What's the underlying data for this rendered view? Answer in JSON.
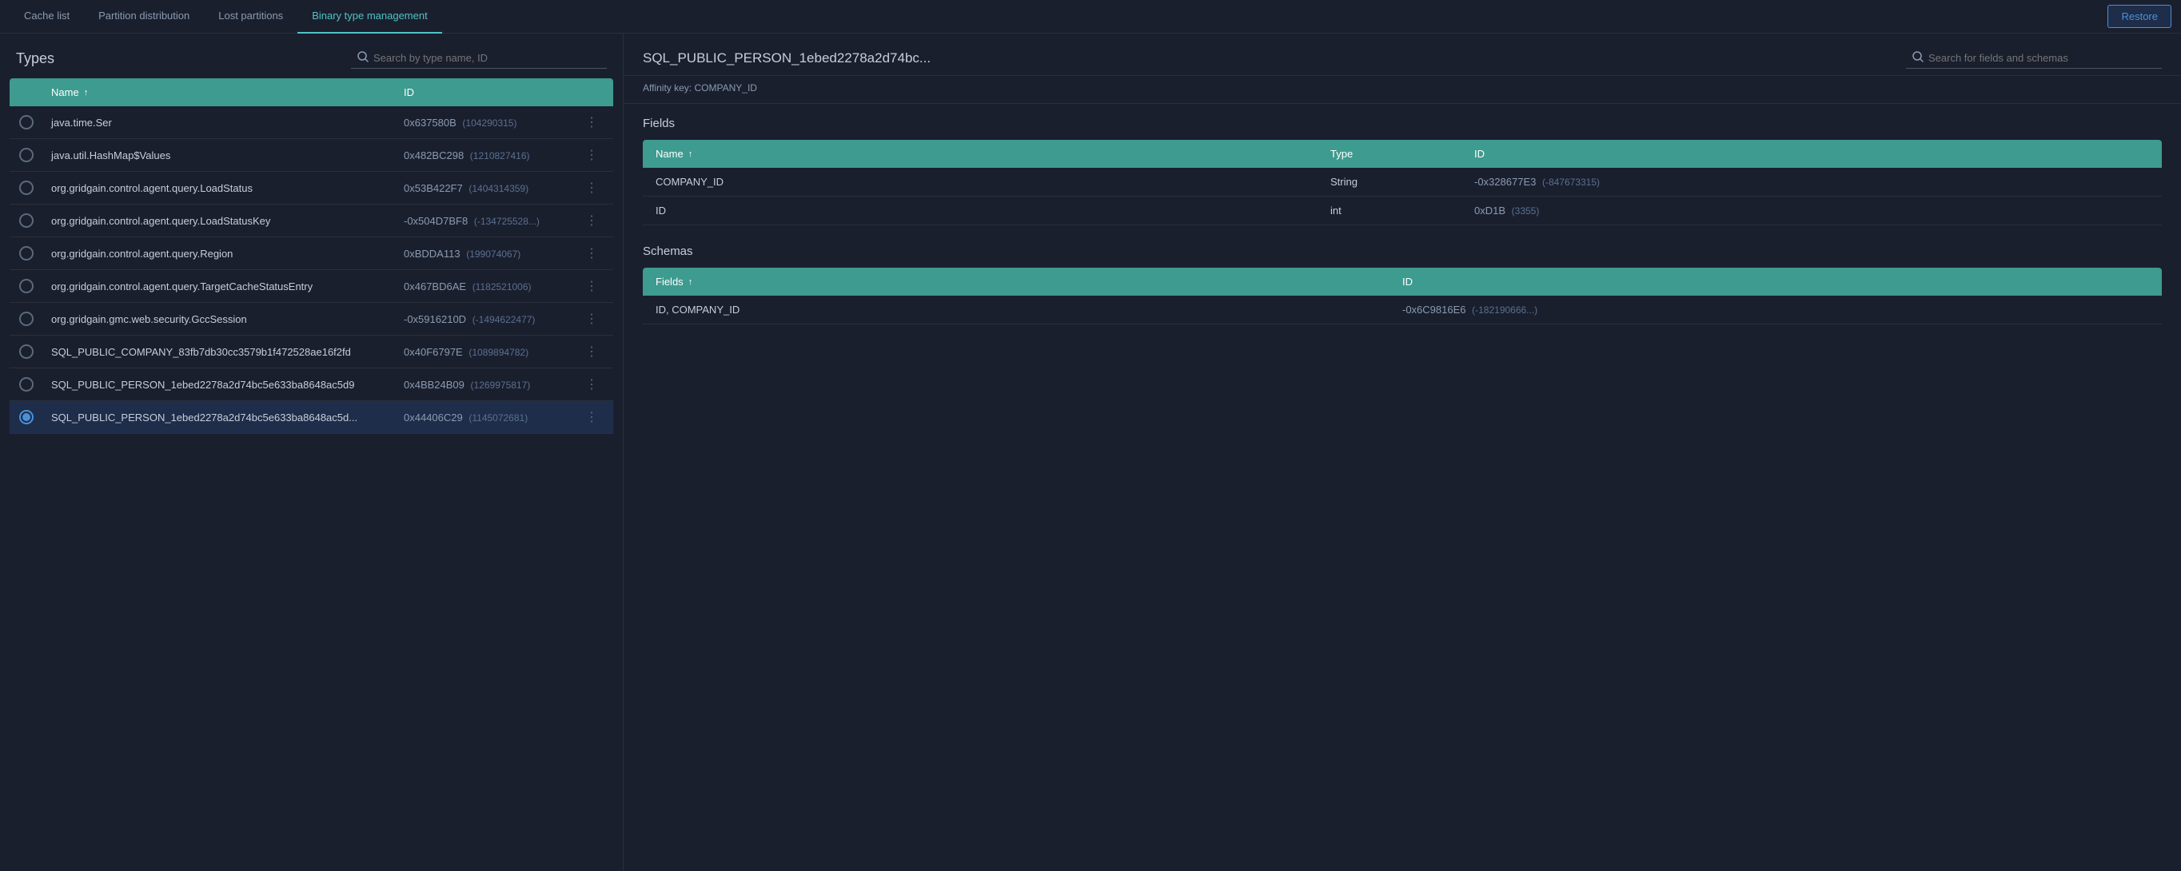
{
  "nav": {
    "tabs": [
      {
        "label": "Cache list",
        "active": false
      },
      {
        "label": "Partition distribution",
        "active": false
      },
      {
        "label": "Lost partitions",
        "active": false
      },
      {
        "label": "Binary type management",
        "active": true
      }
    ],
    "restore_button": "Restore"
  },
  "left_panel": {
    "title": "Types",
    "search": {
      "placeholder": "Search by type name, ID"
    },
    "table": {
      "columns": [
        "Name",
        "ID"
      ],
      "rows": [
        {
          "name": "java.time.Ser",
          "id_hex": "0x637580B",
          "id_dec": "104290315",
          "selected": false
        },
        {
          "name": "java.util.HashMap$Values",
          "id_hex": "0x482BC298",
          "id_dec": "1210827416",
          "selected": false
        },
        {
          "name": "org.gridgain.control.agent.query.LoadStatus",
          "id_hex": "0x53B422F7",
          "id_dec": "1404314359",
          "selected": false
        },
        {
          "name": "org.gridgain.control.agent.query.LoadStatusKey",
          "id_hex": "-0x504D7BF8",
          "id_dec": "-134725528...",
          "selected": false
        },
        {
          "name": "org.gridgain.control.agent.query.Region",
          "id_hex": "0xBDDA113",
          "id_dec": "199074067",
          "selected": false
        },
        {
          "name": "org.gridgain.control.agent.query.TargetCacheStatusEntry",
          "id_hex": "0x467BD6AE",
          "id_dec": "1182521006",
          "selected": false
        },
        {
          "name": "org.gridgain.gmc.web.security.GccSession",
          "id_hex": "-0x5916210D",
          "id_dec": "-1494622477",
          "selected": false
        },
        {
          "name": "SQL_PUBLIC_COMPANY_83fb7db30cc3579b1f472528ae16f2fd",
          "id_hex": "0x40F6797E",
          "id_dec": "1089894782",
          "selected": false
        },
        {
          "name": "SQL_PUBLIC_PERSON_1ebed2278a2d74bc5e633ba8648ac5d9",
          "id_hex": "0x4BB24B09",
          "id_dec": "1269975817",
          "selected": false
        },
        {
          "name": "SQL_PUBLIC_PERSON_1ebed2278a2d74bc5e633ba8648ac5d...",
          "id_hex": "0x44406C29",
          "id_dec": "1145072681",
          "selected": true
        }
      ]
    }
  },
  "right_panel": {
    "title": "SQL_PUBLIC_PERSON_1ebed2278a2d74bc...",
    "search_placeholder": "Search for fields and schemas",
    "affinity_key_label": "Affinity key:",
    "affinity_key_value": "COMPANY_ID",
    "fields_section": {
      "title": "Fields",
      "columns": [
        "Name",
        "Type",
        "ID"
      ],
      "rows": [
        {
          "name": "COMPANY_ID",
          "type": "String",
          "id_hex": "-0x328677E3",
          "id_dec": "-847673315"
        },
        {
          "name": "ID",
          "type": "int",
          "id_hex": "0xD1B",
          "id_dec": "3355"
        }
      ]
    },
    "schemas_section": {
      "title": "Schemas",
      "columns": [
        "Fields",
        "ID"
      ],
      "rows": [
        {
          "fields": "ID, COMPANY_ID",
          "id_hex": "-0x6C9816E6",
          "id_dec": "-182190666..."
        }
      ]
    }
  }
}
